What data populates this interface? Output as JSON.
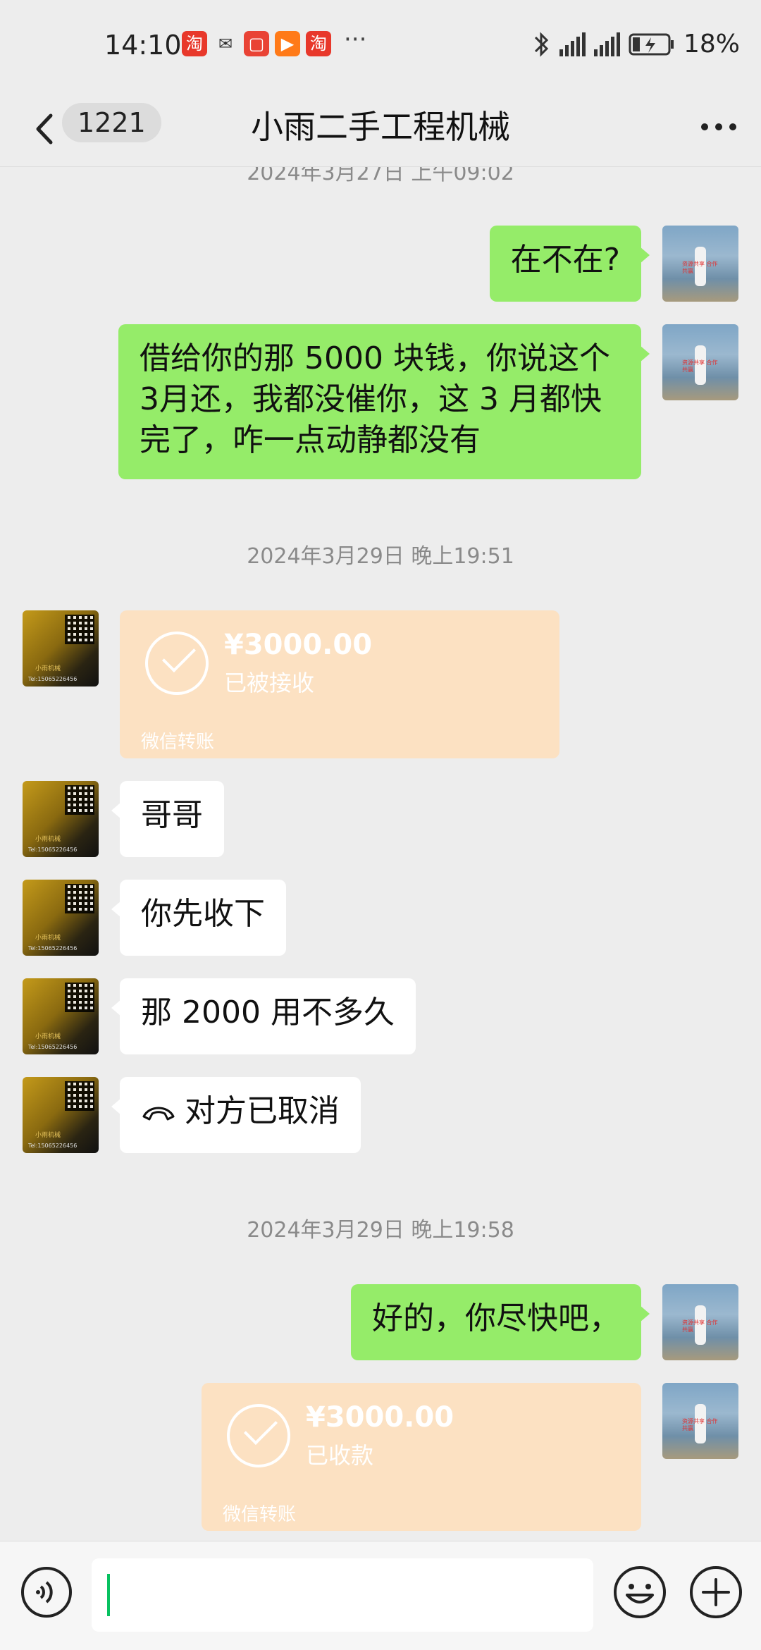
{
  "status_bar": {
    "time": "14:10",
    "app_icons": [
      "taobao-icon",
      "wechat-icon",
      "huawei-store-icon",
      "video-icon",
      "taobao-icon"
    ],
    "more": "···",
    "network": "4G",
    "battery": "18%"
  },
  "header": {
    "unread_count": "1221",
    "title": "小雨二手工程机械"
  },
  "messages": {
    "ts0": "2024年3月27日 上午09:02",
    "m1": "在不在?",
    "m2": "借给你的那 5000 块钱，你说这个3月还，我都没催你，这 3 月都快完了，咋一点动静都没有",
    "ts1": "2024年3月29日 晚上19:51",
    "t1_amount": "¥3000.00",
    "t1_status": "已被接收",
    "t1_source": "微信转账",
    "m3": "哥哥",
    "m4": "你先收下",
    "m5": "那 2000 用不多久",
    "m6": "对方已取消",
    "ts2": "2024年3月29日 晚上19:58",
    "m7": "好的，你尽快吧，",
    "t2_amount": "¥3000.00",
    "t2_status": "已收款",
    "t2_source": "微信转账"
  },
  "colors": {
    "background": "#ededed",
    "self_bubble": "#95ec69",
    "other_bubble": "#ffffff",
    "transfer_card": "#fce1c2",
    "caret": "#07c160"
  }
}
